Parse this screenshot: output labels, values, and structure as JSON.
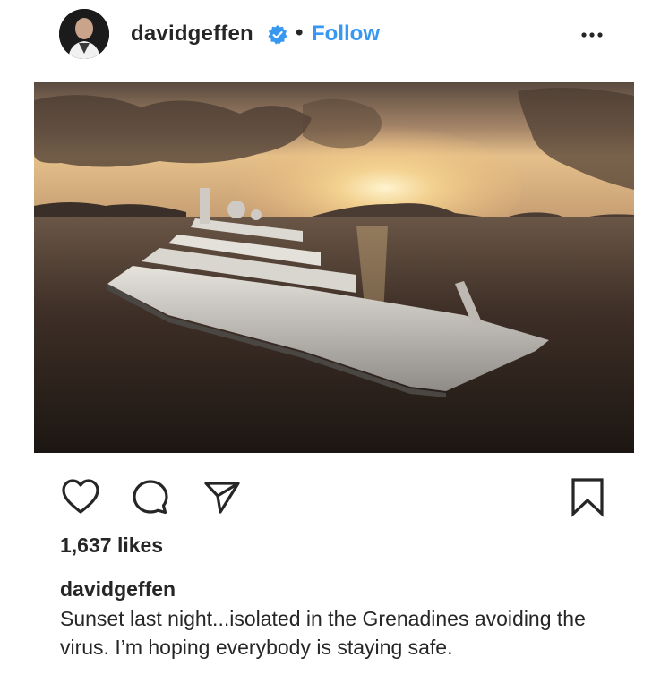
{
  "post": {
    "username": "davidgeffen",
    "separator": "•",
    "follow_label": "Follow",
    "verified": true,
    "accent_color": "#3897f0",
    "likes": "1,637 likes",
    "caption_user": "davidgeffen",
    "caption_text": "Sunset last night...isolated in the Grenadines avoiding the virus. I’m hoping everybody is staying safe."
  },
  "icons": {
    "more": "more-options-icon",
    "like": "heart-icon",
    "comment": "comment-icon",
    "share": "share-icon",
    "save": "bookmark-icon",
    "verified": "verified-badge-icon"
  }
}
